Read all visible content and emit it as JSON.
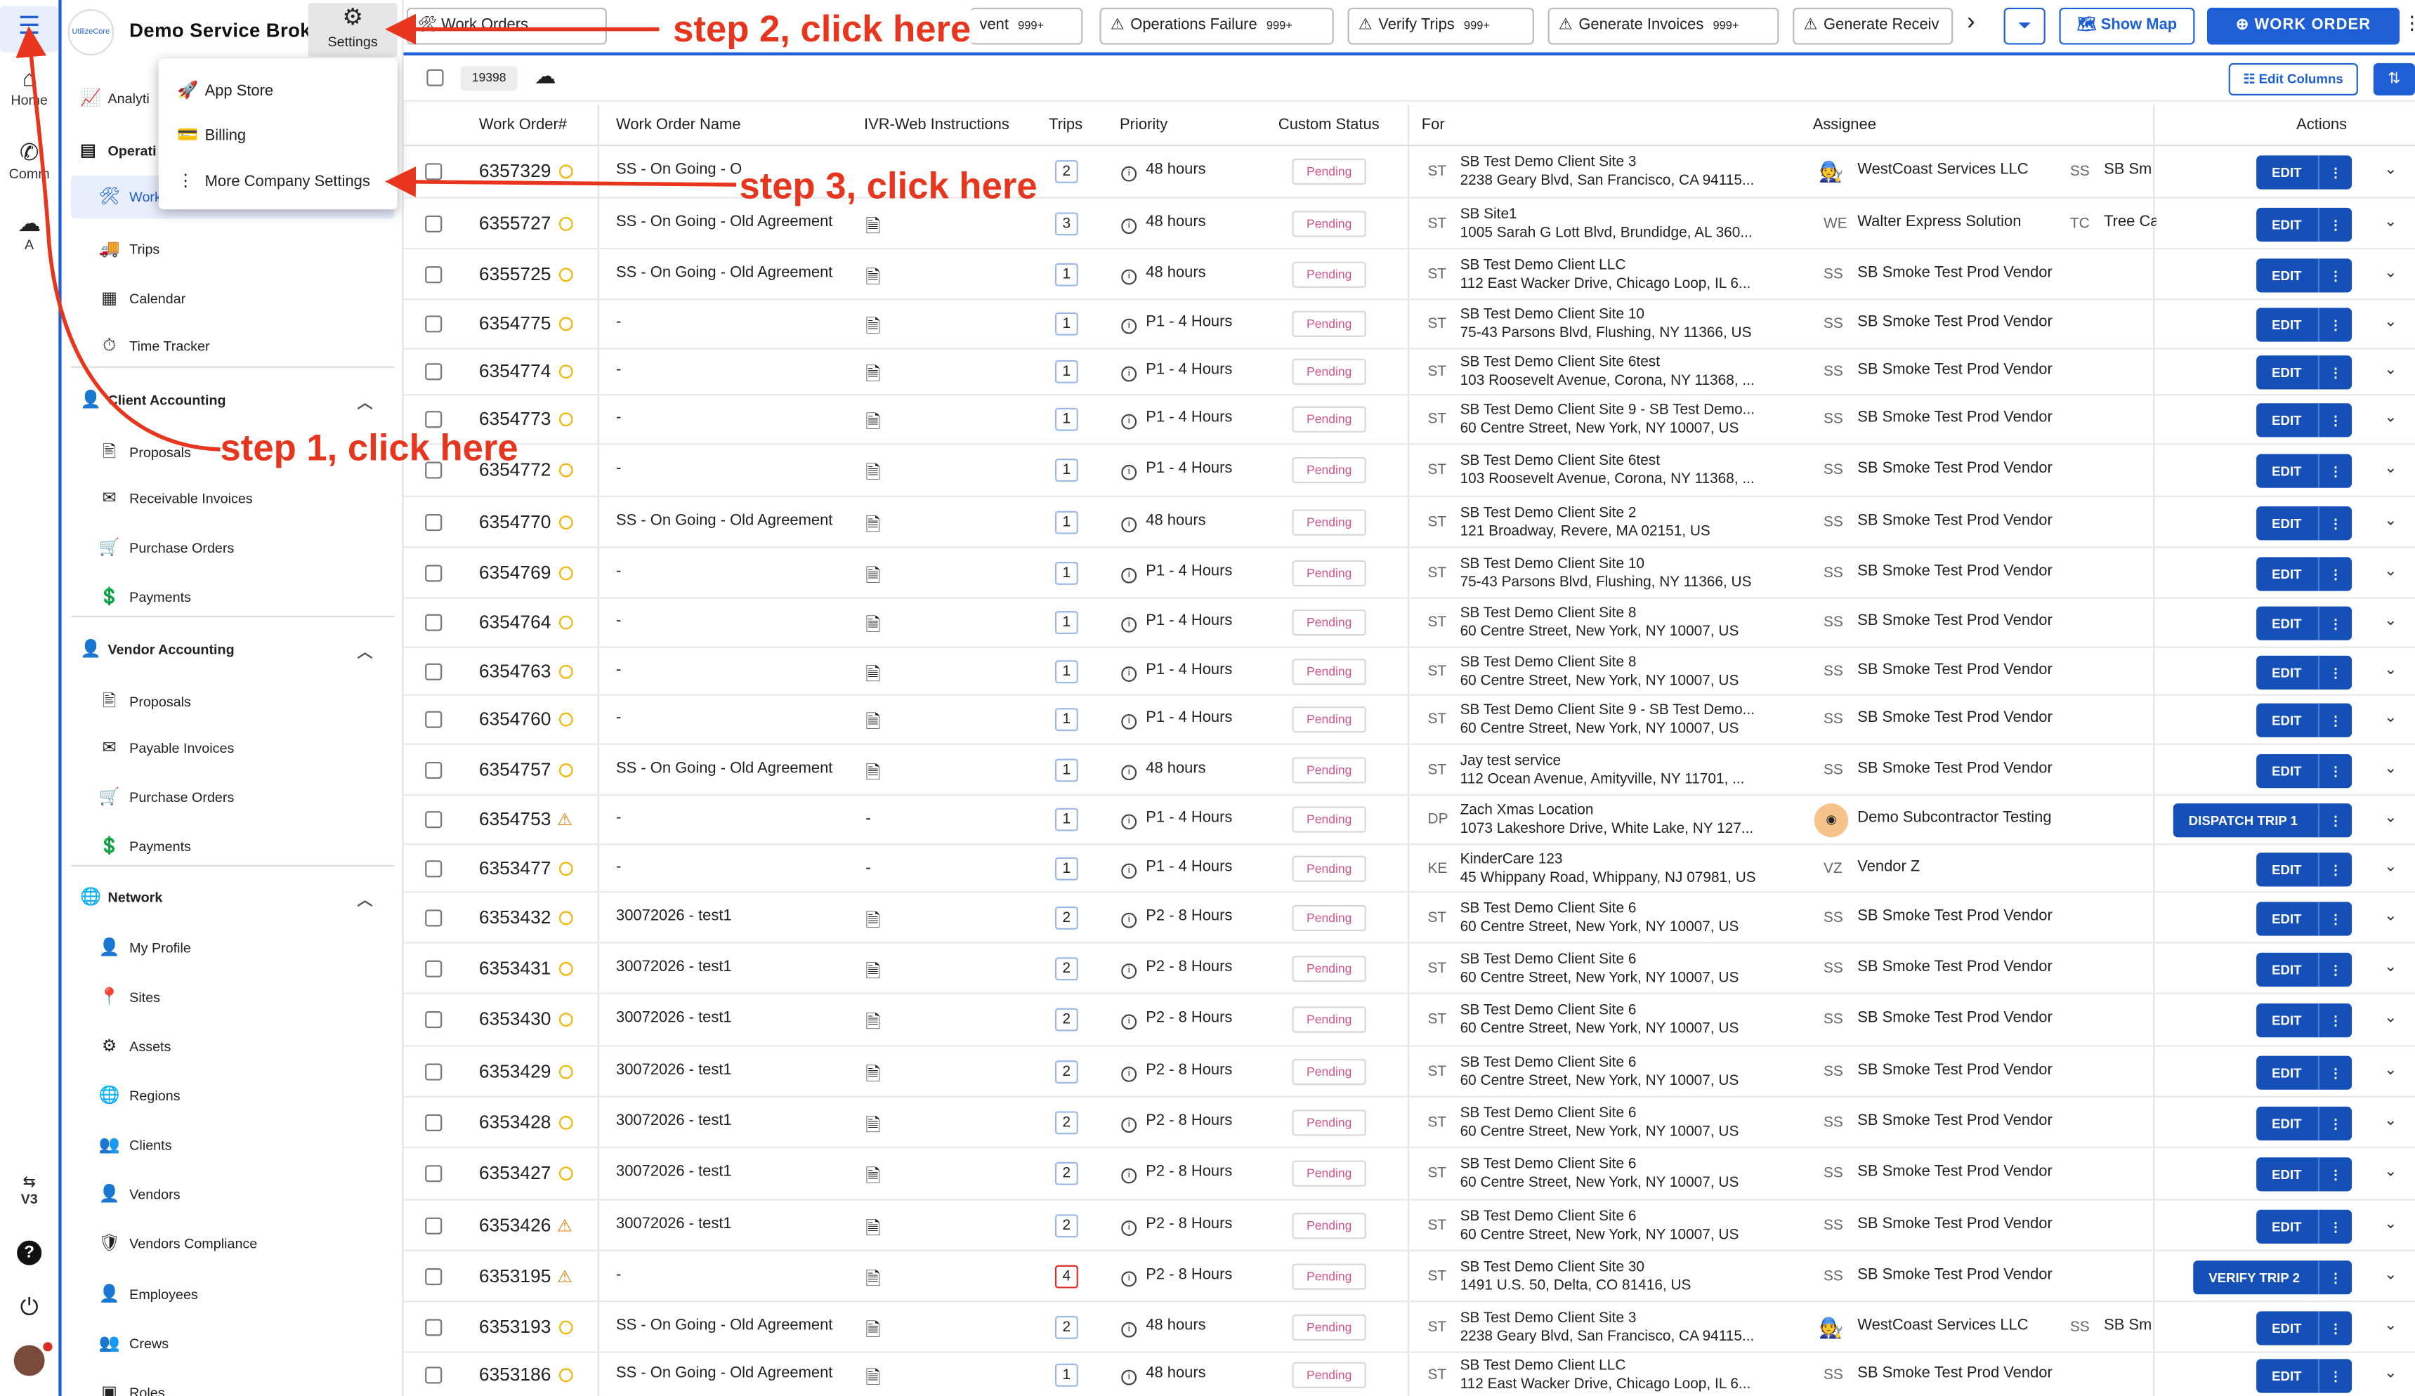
{
  "rail": {
    "home_label": "Home",
    "comm_label": "Comm",
    "a_label": "A",
    "v3_label": "V3"
  },
  "sidebar": {
    "brand_logo_text": "UtilizeCore",
    "brand_name": "Demo Service Broker",
    "analytics_label": "Analyti",
    "operations_label": "Operati",
    "work_label": "Work",
    "trips_label": "Trips",
    "calendar_label": "Calendar",
    "time_tracker_label": "Time Tracker",
    "client_accounting": {
      "title": "Client Accounting",
      "items": [
        "Proposals",
        "Receivable Invoices",
        "Purchase Orders",
        "Payments"
      ]
    },
    "vendor_accounting": {
      "title": "Vendor Accounting",
      "items": [
        "Proposals",
        "Payable Invoices",
        "Purchase Orders",
        "Payments"
      ]
    },
    "network": {
      "title": "Network",
      "items": [
        "My Profile",
        "Sites",
        "Assets",
        "Regions",
        "Clients",
        "Vendors",
        "Vendors Compliance",
        "Employees",
        "Crews",
        "Roles"
      ]
    }
  },
  "settings": {
    "label": "Settings",
    "menu": [
      "App Store",
      "Billing",
      "More Company Settings"
    ]
  },
  "topbar": {
    "breadcrumb": "Work Orders",
    "tabs": [
      {
        "label": "vent",
        "count": "999+"
      },
      {
        "label": "Operations Failure",
        "count": "999+"
      },
      {
        "label": "Verify Trips",
        "count": "999+"
      },
      {
        "label": "Generate Invoices",
        "count": "999+"
      },
      {
        "label": "Generate Receiv",
        "count": ""
      }
    ],
    "show_map": "Show Map",
    "work_order": "WORK ORDER"
  },
  "toolbar": {
    "count": "19398",
    "edit_columns": "Edit Columns"
  },
  "columns": [
    "Work Order#",
    "Work Order Name",
    "IVR-Web Instructions",
    "Trips",
    "Priority",
    "Custom Status",
    "For",
    "Assignee",
    "Actions"
  ],
  "rows": [
    {
      "wo": "6357329",
      "flag": "dot",
      "name": "SS - On Going - O",
      "doc": false,
      "dash": false,
      "trips": "2",
      "trip_red": false,
      "priority": "48 hours",
      "status": "Pending",
      "for_init": "ST",
      "site1": "SB Test Demo Client Site 3",
      "site2": "2238 Geary Blvd, San Francisco, CA 94115...",
      "av_type": "img",
      "av": "",
      "assignee": "WestCoast Services LLC",
      "av2": "SS",
      "assignee2": "SB Sm",
      "action": "EDIT"
    },
    {
      "wo": "6355727",
      "flag": "dot",
      "name": "SS - On Going - Old Agreement",
      "doc": true,
      "dash": false,
      "trips": "3",
      "trip_red": false,
      "priority": "48 hours",
      "status": "Pending",
      "for_init": "ST",
      "site1": "SB Site1",
      "site2": "1005 Sarah G Lott Blvd, Brundidge, AL 360...",
      "av_type": "text",
      "av": "WE",
      "assignee": "Walter Express Solution",
      "av2": "TC",
      "assignee2": "Tree Ca",
      "action": "EDIT"
    },
    {
      "wo": "6355725",
      "flag": "dot",
      "name": "SS - On Going - Old Agreement",
      "doc": true,
      "dash": false,
      "trips": "1",
      "trip_red": false,
      "priority": "48 hours",
      "status": "Pending",
      "for_init": "ST",
      "site1": "SB Test Demo Client LLC",
      "site2": "112 East Wacker Drive, Chicago Loop, IL 6...",
      "av_type": "text",
      "av": "SS",
      "assignee": "SB Smoke Test Prod Vendor",
      "av2": "",
      "assignee2": "",
      "action": "EDIT"
    },
    {
      "wo": "6354775",
      "flag": "dot",
      "name": "-",
      "doc": true,
      "dash": false,
      "trips": "1",
      "trip_red": false,
      "priority": "P1 - 4 Hours",
      "status": "Pending",
      "for_init": "ST",
      "site1": "SB Test Demo Client Site 10",
      "site2": "75-43 Parsons Blvd, Flushing, NY 11366, US",
      "av_type": "text",
      "av": "SS",
      "assignee": "SB Smoke Test Prod Vendor",
      "av2": "",
      "assignee2": "",
      "action": "EDIT"
    },
    {
      "wo": "6354774",
      "flag": "dot",
      "name": "-",
      "doc": true,
      "dash": false,
      "trips": "1",
      "trip_red": false,
      "priority": "P1 - 4 Hours",
      "status": "Pending",
      "for_init": "ST",
      "site1": "SB Test Demo Client Site 6test",
      "site2": "103 Roosevelt Avenue, Corona, NY 11368, ...",
      "av_type": "text",
      "av": "SS",
      "assignee": "SB Smoke Test Prod Vendor",
      "av2": "",
      "assignee2": "",
      "action": "EDIT"
    },
    {
      "wo": "6354773",
      "flag": "dot",
      "name": "-",
      "doc": true,
      "dash": false,
      "trips": "1",
      "trip_red": false,
      "priority": "P1 - 4 Hours",
      "status": "Pending",
      "for_init": "ST",
      "site1": "SB Test Demo Client Site 9 - SB Test Demo...",
      "site2": "60 Centre Street, New York, NY 10007, US",
      "av_type": "text",
      "av": "SS",
      "assignee": "SB Smoke Test Prod Vendor",
      "av2": "",
      "assignee2": "",
      "action": "EDIT"
    },
    {
      "wo": "6354772",
      "flag": "dot",
      "name": "-",
      "doc": true,
      "dash": false,
      "trips": "1",
      "trip_red": false,
      "priority": "P1 - 4 Hours",
      "status": "Pending",
      "for_init": "ST",
      "site1": "SB Test Demo Client Site 6test",
      "site2": "103 Roosevelt Avenue, Corona, NY 11368, ...",
      "av_type": "text",
      "av": "SS",
      "assignee": "SB Smoke Test Prod Vendor",
      "av2": "",
      "assignee2": "",
      "action": "EDIT"
    },
    {
      "wo": "6354770",
      "flag": "dot",
      "name": "SS - On Going - Old Agreement",
      "doc": true,
      "dash": false,
      "trips": "1",
      "trip_red": false,
      "priority": "48 hours",
      "status": "Pending",
      "for_init": "ST",
      "site1": "SB Test Demo Client Site 2",
      "site2": "121 Broadway, Revere, MA 02151, US",
      "av_type": "text",
      "av": "SS",
      "assignee": "SB Smoke Test Prod Vendor",
      "av2": "",
      "assignee2": "",
      "action": "EDIT"
    },
    {
      "wo": "6354769",
      "flag": "dot",
      "name": "-",
      "doc": true,
      "dash": false,
      "trips": "1",
      "trip_red": false,
      "priority": "P1 - 4 Hours",
      "status": "Pending",
      "for_init": "ST",
      "site1": "SB Test Demo Client Site 10",
      "site2": "75-43 Parsons Blvd, Flushing, NY 11366, US",
      "av_type": "text",
      "av": "SS",
      "assignee": "SB Smoke Test Prod Vendor",
      "av2": "",
      "assignee2": "",
      "action": "EDIT"
    },
    {
      "wo": "6354764",
      "flag": "dot",
      "name": "-",
      "doc": true,
      "dash": false,
      "trips": "1",
      "trip_red": false,
      "priority": "P1 - 4 Hours",
      "status": "Pending",
      "for_init": "ST",
      "site1": "SB Test Demo Client Site 8",
      "site2": "60 Centre Street, New York, NY 10007, US",
      "av_type": "text",
      "av": "SS",
      "assignee": "SB Smoke Test Prod Vendor",
      "av2": "",
      "assignee2": "",
      "action": "EDIT"
    },
    {
      "wo": "6354763",
      "flag": "dot",
      "name": "-",
      "doc": true,
      "dash": false,
      "trips": "1",
      "trip_red": false,
      "priority": "P1 - 4 Hours",
      "status": "Pending",
      "for_init": "ST",
      "site1": "SB Test Demo Client Site 8",
      "site2": "60 Centre Street, New York, NY 10007, US",
      "av_type": "text",
      "av": "SS",
      "assignee": "SB Smoke Test Prod Vendor",
      "av2": "",
      "assignee2": "",
      "action": "EDIT"
    },
    {
      "wo": "6354760",
      "flag": "dot",
      "name": "-",
      "doc": true,
      "dash": false,
      "trips": "1",
      "trip_red": false,
      "priority": "P1 - 4 Hours",
      "status": "Pending",
      "for_init": "ST",
      "site1": "SB Test Demo Client Site 9 - SB Test Demo...",
      "site2": "60 Centre Street, New York, NY 10007, US",
      "av_type": "text",
      "av": "SS",
      "assignee": "SB Smoke Test Prod Vendor",
      "av2": "",
      "assignee2": "",
      "action": "EDIT"
    },
    {
      "wo": "6354757",
      "flag": "dot",
      "name": "SS - On Going - Old Agreement",
      "doc": true,
      "dash": false,
      "trips": "1",
      "trip_red": false,
      "priority": "48 hours",
      "status": "Pending",
      "for_init": "ST",
      "site1": "Jay test service",
      "site2": "112 Ocean Avenue, Amityville, NY 11701, ...",
      "av_type": "text",
      "av": "SS",
      "assignee": "SB Smoke Test Prod Vendor",
      "av2": "",
      "assignee2": "",
      "action": "EDIT"
    },
    {
      "wo": "6354753",
      "flag": "warn",
      "name": "-",
      "doc": false,
      "dash": true,
      "trips": "1",
      "trip_red": false,
      "priority": "P1 - 4 Hours",
      "status": "Pending",
      "for_init": "DP",
      "site1": "Zach Xmas Location",
      "site2": "1073 Lakeshore Drive, White Lake, NY 127...",
      "av_type": "img2",
      "av": "",
      "assignee": "Demo Subcontractor Testing",
      "av2": "",
      "assignee2": "",
      "action": "DISPATCH TRIP 1"
    },
    {
      "wo": "6353477",
      "flag": "dot",
      "name": "-",
      "doc": false,
      "dash": true,
      "trips": "1",
      "trip_red": false,
      "priority": "P1 - 4 Hours",
      "status": "Pending",
      "for_init": "KE",
      "site1": "KinderCare 123",
      "site2": "45 Whippany Road, Whippany, NJ 07981, US",
      "av_type": "text",
      "av": "VZ",
      "assignee": "Vendor Z",
      "av2": "",
      "assignee2": "",
      "action": "EDIT"
    },
    {
      "wo": "6353432",
      "flag": "dot",
      "name": "30072026 - test1",
      "doc": true,
      "dash": false,
      "trips": "2",
      "trip_red": false,
      "priority": "P2 - 8 Hours",
      "status": "Pending",
      "for_init": "ST",
      "site1": "SB Test Demo Client Site 6",
      "site2": "60 Centre Street, New York, NY 10007, US",
      "av_type": "text",
      "av": "SS",
      "assignee": "SB Smoke Test Prod Vendor",
      "av2": "",
      "assignee2": "",
      "action": "EDIT"
    },
    {
      "wo": "6353431",
      "flag": "dot",
      "name": "30072026 - test1",
      "doc": true,
      "dash": false,
      "trips": "2",
      "trip_red": false,
      "priority": "P2 - 8 Hours",
      "status": "Pending",
      "for_init": "ST",
      "site1": "SB Test Demo Client Site 6",
      "site2": "60 Centre Street, New York, NY 10007, US",
      "av_type": "text",
      "av": "SS",
      "assignee": "SB Smoke Test Prod Vendor",
      "av2": "",
      "assignee2": "",
      "action": "EDIT"
    },
    {
      "wo": "6353430",
      "flag": "dot",
      "name": "30072026 - test1",
      "doc": true,
      "dash": false,
      "trips": "2",
      "trip_red": false,
      "priority": "P2 - 8 Hours",
      "status": "Pending",
      "for_init": "ST",
      "site1": "SB Test Demo Client Site 6",
      "site2": "60 Centre Street, New York, NY 10007, US",
      "av_type": "text",
      "av": "SS",
      "assignee": "SB Smoke Test Prod Vendor",
      "av2": "",
      "assignee2": "",
      "action": "EDIT"
    },
    {
      "wo": "6353429",
      "flag": "dot",
      "name": "30072026 - test1",
      "doc": true,
      "dash": false,
      "trips": "2",
      "trip_red": false,
      "priority": "P2 - 8 Hours",
      "status": "Pending",
      "for_init": "ST",
      "site1": "SB Test Demo Client Site 6",
      "site2": "60 Centre Street, New York, NY 10007, US",
      "av_type": "text",
      "av": "SS",
      "assignee": "SB Smoke Test Prod Vendor",
      "av2": "",
      "assignee2": "",
      "action": "EDIT"
    },
    {
      "wo": "6353428",
      "flag": "dot",
      "name": "30072026 - test1",
      "doc": true,
      "dash": false,
      "trips": "2",
      "trip_red": false,
      "priority": "P2 - 8 Hours",
      "status": "Pending",
      "for_init": "ST",
      "site1": "SB Test Demo Client Site 6",
      "site2": "60 Centre Street, New York, NY 10007, US",
      "av_type": "text",
      "av": "SS",
      "assignee": "SB Smoke Test Prod Vendor",
      "av2": "",
      "assignee2": "",
      "action": "EDIT"
    },
    {
      "wo": "6353427",
      "flag": "dot",
      "name": "30072026 - test1",
      "doc": true,
      "dash": false,
      "trips": "2",
      "trip_red": false,
      "priority": "P2 - 8 Hours",
      "status": "Pending",
      "for_init": "ST",
      "site1": "SB Test Demo Client Site 6",
      "site2": "60 Centre Street, New York, NY 10007, US",
      "av_type": "text",
      "av": "SS",
      "assignee": "SB Smoke Test Prod Vendor",
      "av2": "",
      "assignee2": "",
      "action": "EDIT"
    },
    {
      "wo": "6353426",
      "flag": "warn",
      "name": "30072026 - test1",
      "doc": true,
      "dash": false,
      "trips": "2",
      "trip_red": false,
      "priority": "P2 - 8 Hours",
      "status": "Pending",
      "for_init": "ST",
      "site1": "SB Test Demo Client Site 6",
      "site2": "60 Centre Street, New York, NY 10007, US",
      "av_type": "text",
      "av": "SS",
      "assignee": "SB Smoke Test Prod Vendor",
      "av2": "",
      "assignee2": "",
      "action": "EDIT"
    },
    {
      "wo": "6353195",
      "flag": "warn",
      "name": "-",
      "doc": true,
      "dash": false,
      "trips": "4",
      "trip_red": true,
      "priority": "P2 - 8 Hours",
      "status": "Pending",
      "for_init": "ST",
      "site1": "SB Test Demo Client Site 30",
      "site2": "1491 U.S. 50, Delta, CO 81416, US",
      "av_type": "text",
      "av": "SS",
      "assignee": "SB Smoke Test Prod Vendor",
      "av2": "",
      "assignee2": "",
      "action": "VERIFY TRIP 2"
    },
    {
      "wo": "6353193",
      "flag": "dot",
      "name": "SS - On Going - Old Agreement",
      "doc": true,
      "dash": false,
      "trips": "2",
      "trip_red": false,
      "priority": "48 hours",
      "status": "Pending",
      "for_init": "ST",
      "site1": "SB Test Demo Client Site 3",
      "site2": "2238 Geary Blvd, San Francisco, CA 94115...",
      "av_type": "img",
      "av": "",
      "assignee": "WestCoast Services LLC",
      "av2": "SS",
      "assignee2": "SB Sm",
      "action": "EDIT"
    },
    {
      "wo": "6353186",
      "flag": "dot",
      "name": "SS - On Going - Old Agreement",
      "doc": true,
      "dash": false,
      "trips": "1",
      "trip_red": false,
      "priority": "48 hours",
      "status": "Pending",
      "for_init": "ST",
      "site1": "SB Test Demo Client LLC",
      "site2": "112 East Wacker Drive, Chicago Loop, IL 6...",
      "av_type": "text",
      "av": "SS",
      "assignee": "SB Smoke Test Prod Vendor",
      "av2": "",
      "assignee2": "",
      "action": "EDIT"
    }
  ],
  "annotations": {
    "step1": "step 1, click here",
    "step2": "step 2, click here",
    "step3": "step 3, click here",
    "color": "#e8361e"
  },
  "colors": {
    "accent": "#1e5fd6",
    "button": "#1550b8",
    "pending": "#d0548c",
    "warning": "#e67c00"
  }
}
